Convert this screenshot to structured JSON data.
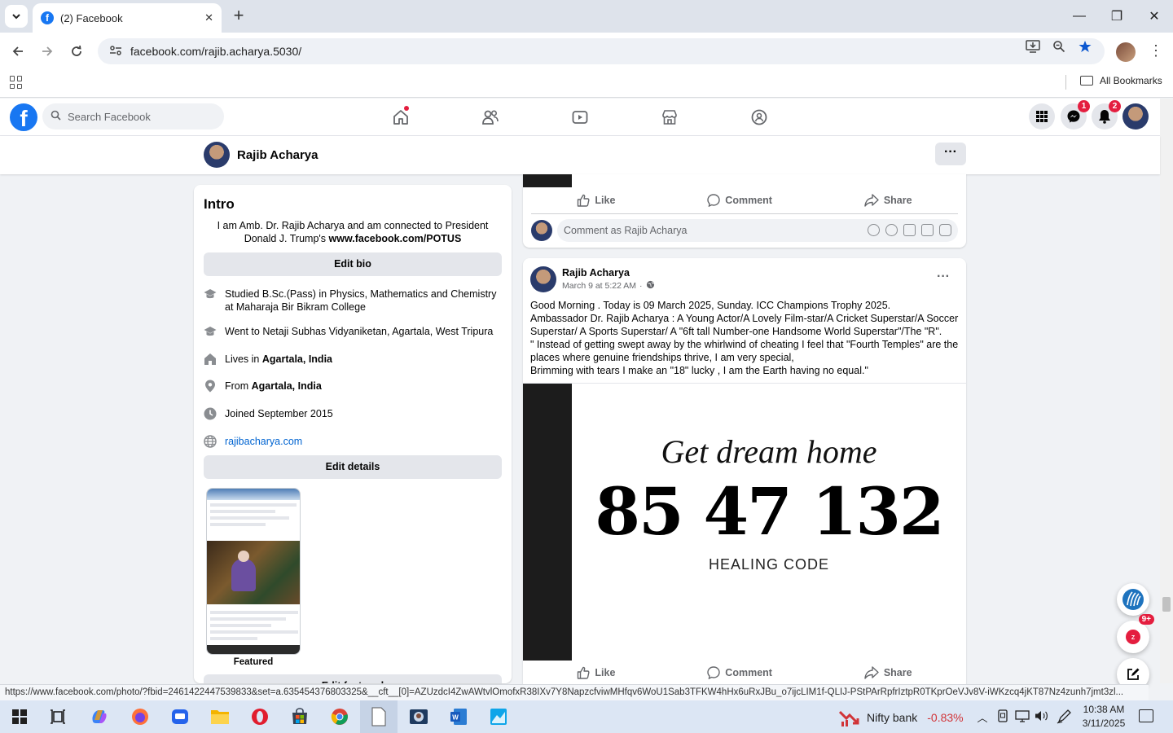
{
  "browser": {
    "tab_title": "(2) Facebook",
    "url": "facebook.com/rajib.acharya.5030/",
    "all_bookmarks": "All Bookmarks",
    "status_url": "https://www.facebook.com/photo/?fbid=2461422447539833&set=a.635454376803325&__cft__[0]=AZUzdcI4ZwAWtvlOmofxR38IXv7Y8NapzcfviwMHfqv6WoU1Sab3TFKW4hHx6uRxJBu_o7ijcLIM1f-QLIJ-PStPArRpfrIztpR0TKprOeVJv8V-iWKzcq4jKT87Nz4zunh7jmt3zl..."
  },
  "fb": {
    "search_placeholder": "Search Facebook",
    "messenger_badge": "1",
    "notifications_badge": "2"
  },
  "profile": {
    "name": "Rajib Acharya",
    "more": "···"
  },
  "intro": {
    "heading": "Intro",
    "bio_text": "I am Amb. Dr. Rajib Acharya and am connected to President Donald J. Trump's ",
    "bio_link": "www.facebook.com/POTUS",
    "edit_bio": "Edit bio",
    "details": {
      "studied": "Studied B.Sc.(Pass) in Physics, Mathematics and Chemistry at Maharaja Bir Bikram College",
      "went_to": "Went to Netaji Subhas Vidyaniketan, Agartala, West Tripura",
      "lives_prefix": "Lives in ",
      "lives_place": "Agartala, India",
      "from_prefix": "From ",
      "from_place": "Agartala, India",
      "joined": "Joined September 2015",
      "website": "rajibacharya.com"
    },
    "edit_details": "Edit details",
    "featured_label": "Featured",
    "edit_featured": "Edit featured"
  },
  "previous_post": {
    "like": "Like",
    "comment": "Comment",
    "share": "Share",
    "comment_placeholder": "Comment as Rajib Acharya"
  },
  "post": {
    "author": "Rajib Acharya",
    "timestamp": "March 9 at 5:22 AM",
    "separator": "·",
    "more": "···",
    "lines": [
      "Good Morning . Today is 09 March 2025, Sunday. ICC Champions Trophy 2025.",
      "Ambassador Dr. Rajib Acharya : A Young Actor/A Lovely Film-star/A Cricket Superstar/A Soccer Superstar/ A Sports Superstar/ A \"6ft tall Number-one Handsome World Superstar\"/The \"R\".",
      "\" Instead of getting swept away by the whirlwind of cheating I feel that \"Fourth Temples\" are the places where genuine friendships thrive, I am very special,",
      "Brimming with tears I make an \"18\" lucky , I am the Earth having no equal.\""
    ],
    "image": {
      "script": "Get dream home",
      "number": "85 47 132",
      "subtitle": "HEALING CODE"
    },
    "like": "Like",
    "comment": "Comment",
    "share": "Share"
  },
  "floating": {
    "news_badge": "9+"
  },
  "taskbar": {
    "stock_name": "Nifty bank",
    "stock_change": "-0.83%",
    "time": "10:38 AM",
    "date": "3/11/2025"
  },
  "colors": {
    "fb_blue": "#1877f2",
    "badge_red": "#e41e3f",
    "stock_red": "#d13438"
  }
}
